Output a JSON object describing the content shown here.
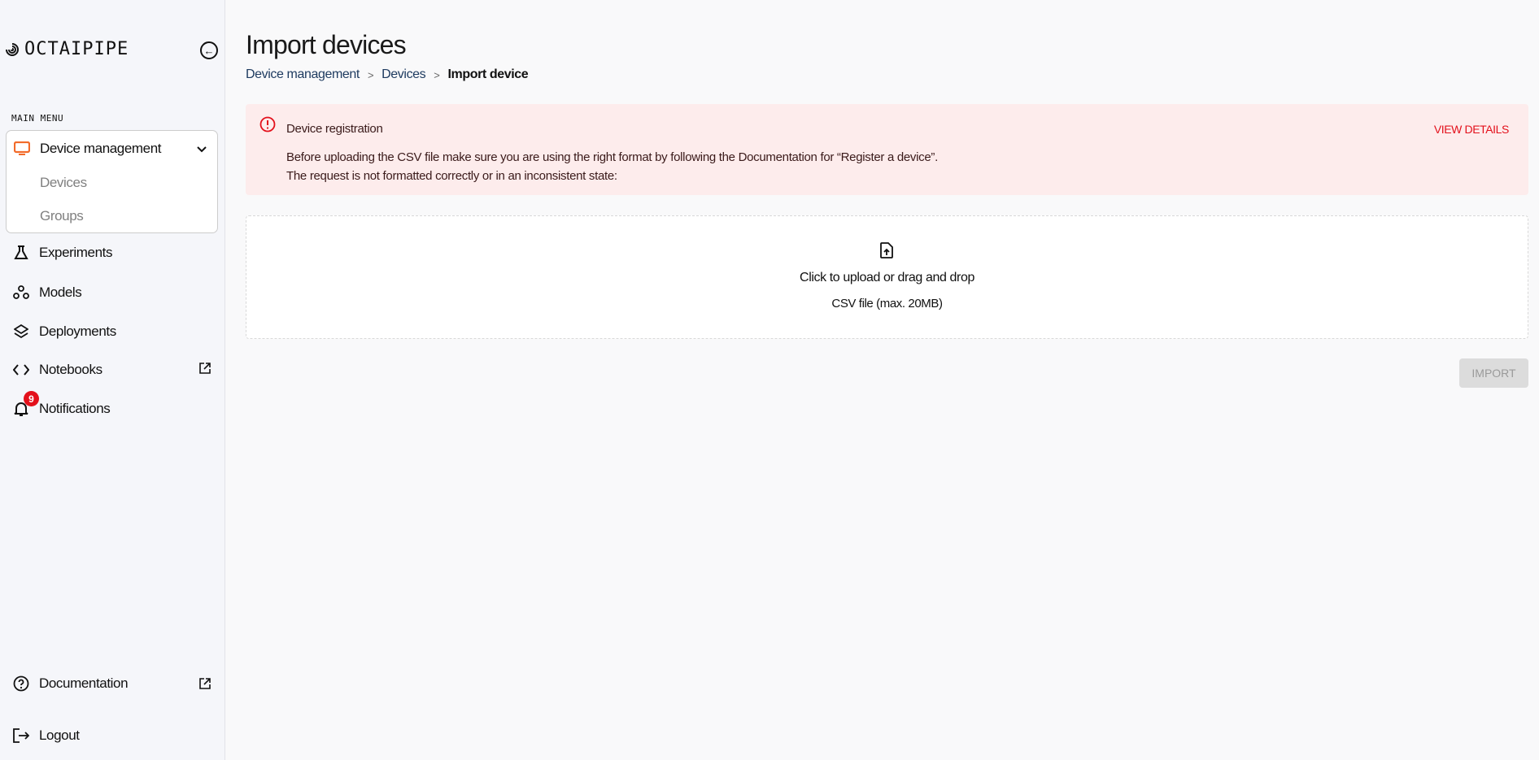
{
  "sidebar": {
    "brand": "OCTAIPIPE",
    "menu_heading": "MAIN MENU",
    "device_management": {
      "label": "Device management",
      "children": [
        {
          "label": "Devices"
        },
        {
          "label": "Groups"
        }
      ]
    },
    "items": [
      {
        "label": "Experiments",
        "icon": "flask-icon"
      },
      {
        "label": "Models",
        "icon": "nodes-icon"
      },
      {
        "label": "Deployments",
        "icon": "layers-icon"
      },
      {
        "label": "Notebooks",
        "icon": "code-icon",
        "external": true
      },
      {
        "label": "Notifications",
        "icon": "bell-icon",
        "badge": "9"
      }
    ],
    "footer": [
      {
        "label": "Documentation",
        "external": true
      },
      {
        "label": "Logout"
      }
    ],
    "accent": "#f26b2a"
  },
  "page": {
    "title": "Import devices",
    "breadcrumb": [
      "Device management",
      "Devices",
      "Import device"
    ],
    "breadcrumb_sep": ">"
  },
  "alert": {
    "title": "Device registration",
    "line1": "Before uploading the CSV file make sure you are using the right format by following the Documentation for “Register a device”.",
    "line2": "The request is not formatted correctly or in an inconsistent state:",
    "action": "VIEW DETAILS",
    "color": "#e3101b"
  },
  "upload": {
    "primary": "Click to upload or drag and drop",
    "secondary": "CSV file (max. 20MB)"
  },
  "import_button": "IMPORT"
}
